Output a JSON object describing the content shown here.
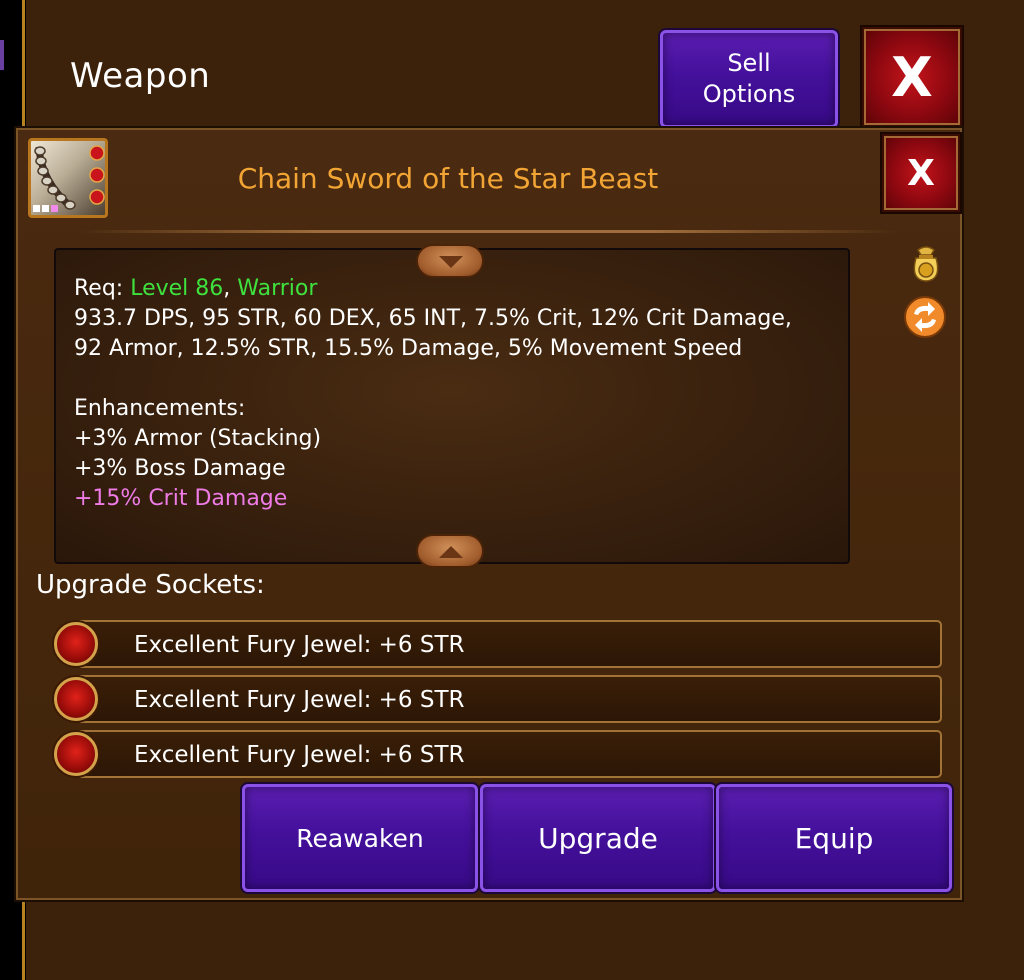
{
  "header": {
    "title": "Weapon",
    "sell_label_line1": "Sell",
    "sell_label_line2": "Options",
    "close_label": "X"
  },
  "item": {
    "name": "Chain Sword of the Star Beast",
    "close_label": "X",
    "icon": "chain-sword-icon",
    "req_prefix": "Req: ",
    "req_level": "Level 86",
    "req_sep": ", ",
    "req_class": "Warrior",
    "stats_line1": "933.7 DPS, 95 STR, 60 DEX, 65 INT, 7.5% Crit, 12% Crit Damage,",
    "stats_line2": "92 Armor, 12.5% STR, 15.5% Damage, 5% Movement Speed",
    "enhancements_heading": "Enhancements:",
    "enhancements": [
      "+3% Armor (Stacking)",
      "+3% Boss Damage",
      "+15% Crit Damage"
    ]
  },
  "sockets": {
    "heading": "Upgrade Sockets:",
    "items": [
      "Excellent Fury Jewel: +6 STR",
      "Excellent Fury Jewel: +6 STR",
      "Excellent Fury Jewel: +6 STR"
    ]
  },
  "actions": {
    "reawaken": "Reawaken",
    "upgrade": "Upgrade",
    "equip": "Equip"
  },
  "colors": {
    "requirement_green": "#3ee13e",
    "rare_pink": "#ef7be7",
    "title_orange": "#f2a535",
    "button_purple": "#44109b",
    "close_red": "#8e0810"
  }
}
